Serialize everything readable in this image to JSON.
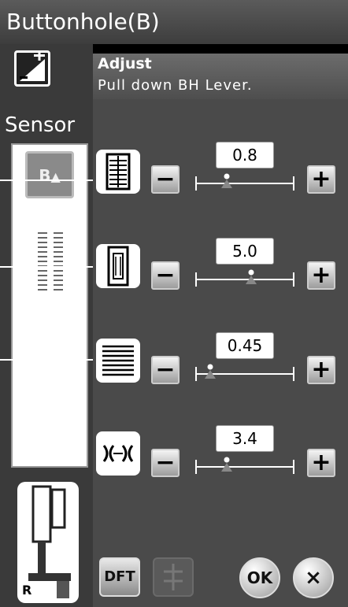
{
  "window": {
    "title": "Buttonhole(B)"
  },
  "sidebar": {
    "sensor_label": "Sensor",
    "bh_badge": "B",
    "foot_label": "R"
  },
  "panel": {
    "title": "Adjust",
    "instruction": "Pull down BH Lever.",
    "rows": [
      {
        "icon": "buttonhole-width-icon",
        "value": "0.8",
        "slider_fraction": 0.32
      },
      {
        "icon": "buttonhole-length-icon",
        "value": "5.0",
        "slider_fraction": 0.56
      },
      {
        "icon": "stitch-density-icon",
        "value": "0.45",
        "slider_fraction": 0.15
      },
      {
        "icon": "cutting-space-icon",
        "value": "3.4",
        "slider_fraction": 0.32
      }
    ],
    "minus_label": "−",
    "plus_label": "+",
    "dft_label": "DFT",
    "ok_label": "OK",
    "close_label": "×"
  },
  "colors": {
    "slider_marker": "#888888"
  }
}
